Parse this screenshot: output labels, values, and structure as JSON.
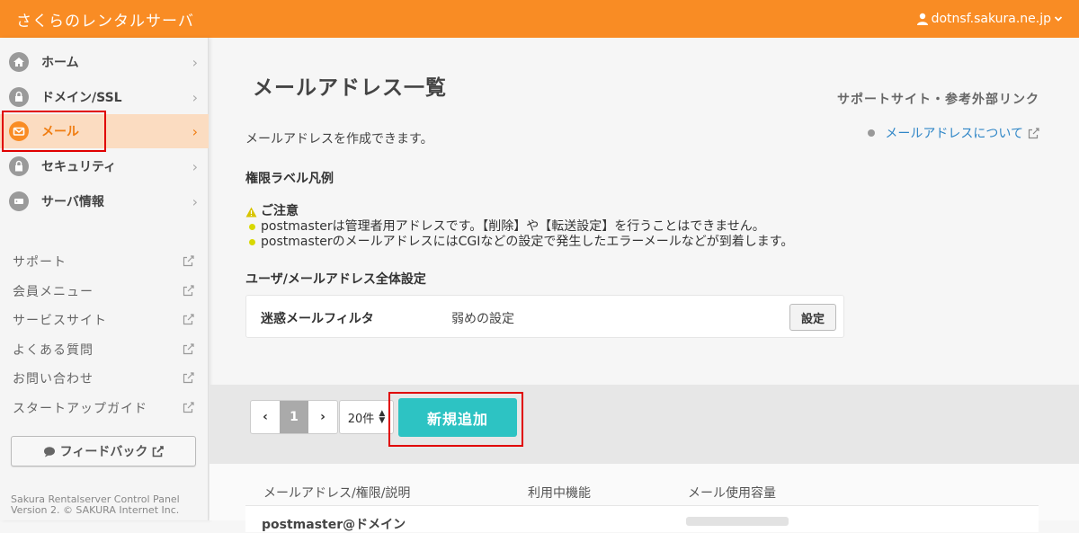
{
  "header": {
    "brand": "さくらのレンタルサーバ",
    "account": "dotnsf.sakura.ne.jp"
  },
  "sidebar": {
    "nav": [
      {
        "label": "ホーム",
        "icon": "home-icon",
        "active": false
      },
      {
        "label": "ドメイン/SSL",
        "icon": "domain-lock-icon",
        "active": false
      },
      {
        "label": "メール",
        "icon": "mail-icon",
        "active": true
      },
      {
        "label": "セキュリティ",
        "icon": "lock-icon",
        "active": false
      },
      {
        "label": "サーバ情報",
        "icon": "server-icon",
        "active": false
      }
    ],
    "links": [
      "サポート",
      "会員メニュー",
      "サービスサイト",
      "よくある質問",
      "お問い合わせ",
      "スタートアップガイド"
    ],
    "feedback": "フィードバック",
    "copyright_line1": "Sakura Rentalserver Control Panel",
    "copyright_line2": "Version 2. © SAKURA Internet Inc."
  },
  "main": {
    "title": "メールアドレス一覧",
    "description": "メールアドレスを作成できます。",
    "support_title": "サポートサイト・参考外部リンク",
    "support_link": "メールアドレスについて",
    "legend_heading": "権限ラベル凡例",
    "caution_title": "ご注意",
    "caution_items": [
      "postmasterは管理者用アドレスです。【削除】や【転送設定】を行うことはできません。",
      "postmasterのメールアドレスにはCGIなどの設定で発生したエラーメールなどが到着します。"
    ],
    "settings_heading": "ユーザ/メールアドレス全体設定",
    "filter_label": "迷惑メールフィルタ",
    "filter_value": "弱めの設定",
    "filter_button": "設定"
  },
  "toolbar": {
    "page": "1",
    "per_page": "20件",
    "add_button": "新規追加"
  },
  "table": {
    "columns": [
      "メールアドレス/権限/説明",
      "利用中機能",
      "メール使用容量"
    ],
    "rows": [
      {
        "address": "postmaster@ドメイン"
      }
    ]
  },
  "colors": {
    "brand": "#f98c24",
    "active_bg": "#fbdcc1",
    "add_button": "#2dc3c3",
    "highlight": "#e00000",
    "link": "#2f86c7"
  }
}
